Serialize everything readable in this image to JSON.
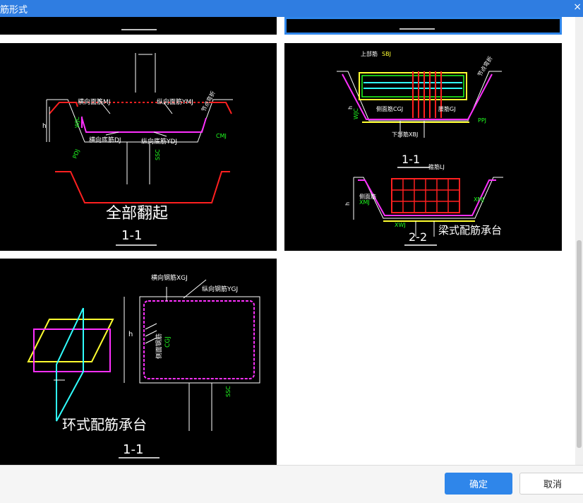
{
  "window": {
    "title": "筋形式",
    "close_glyph": "×"
  },
  "cells": {
    "full_flip": {
      "caption": "全部翻起",
      "section": "1-1",
      "labels": {
        "top_transverse": "横向面筋MJ",
        "top_longitudinal": "纵向面筋YMJ",
        "bottom_transverse": "横向底筋DJ",
        "bottom_longitudinal": "纵向底筋YDJ",
        "side_bend": "节点弯折",
        "side_rebar": "CMJ",
        "h": "h",
        "pdj": "PDJ",
        "ssc": "SSC",
        "wjc": "WJC"
      }
    },
    "beam_type": {
      "caption": "梁式配筋承台",
      "section_a": "1-1",
      "section_b": "2-2",
      "labels": {
        "top_bar": "上部筋",
        "top_bar_code": "SBJ",
        "side_face": "侧面筋CGJ",
        "waist": "腰筋GJ",
        "bottom_bar": "下部筋XBJ",
        "stirrup": "箍筋LJ",
        "bend": "节点弯折",
        "ppj": "PPJ",
        "xmj": "XMJ",
        "xwj": "XWJ",
        "side_b": "侧面筋",
        "h": "h",
        "wjc": "WJC"
      }
    },
    "ring_type": {
      "caption": "环式配筋承台",
      "section": "1-1",
      "labels": {
        "transverse": "横向钢筋XGJ",
        "longitudinal": "纵向钢筋YGJ",
        "side_face": "侧面钢筋",
        "side_code": "CGJ",
        "h": "h",
        "ssc": "SSC"
      }
    }
  },
  "buttons": {
    "ok": "确定",
    "cancel": "取消"
  }
}
